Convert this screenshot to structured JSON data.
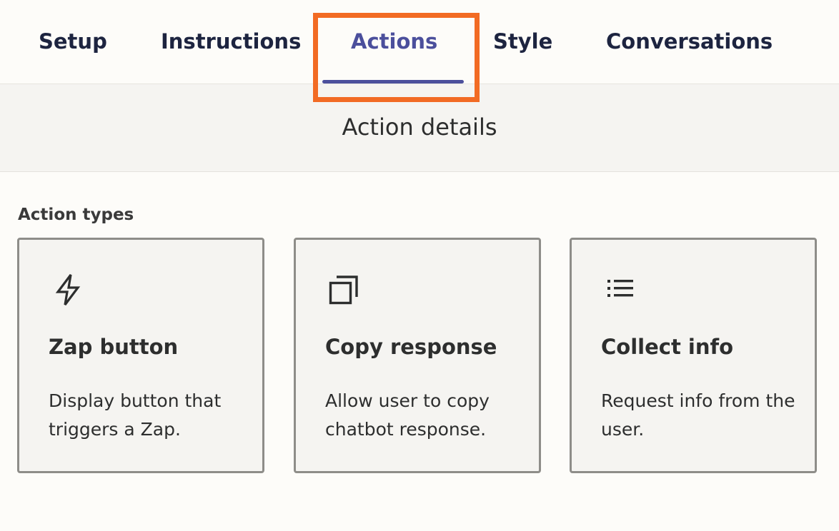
{
  "tabs": [
    {
      "label": "Setup",
      "active": false
    },
    {
      "label": "Instructions",
      "active": false
    },
    {
      "label": "Actions",
      "active": true
    },
    {
      "label": "Style",
      "active": false
    },
    {
      "label": "Conversations",
      "active": false
    }
  ],
  "highlight": {
    "color": "#f26b24",
    "target": "Actions"
  },
  "details": {
    "title": "Action details"
  },
  "action_types": {
    "label": "Action types",
    "cards": [
      {
        "icon": "lightning-icon",
        "title": "Zap button",
        "description": "Display button that triggers a Zap."
      },
      {
        "icon": "copy-icon",
        "title": "Copy response",
        "description": "Allow user to copy chatbot response."
      },
      {
        "icon": "list-icon",
        "title": "Collect info",
        "description": "Request info from the user."
      }
    ]
  },
  "colors": {
    "accent": "#4b4f9c",
    "tab_text": "#1d2440",
    "highlight_border": "#f26b24",
    "card_border": "#8e8d89",
    "background": "#fdfcf9"
  }
}
